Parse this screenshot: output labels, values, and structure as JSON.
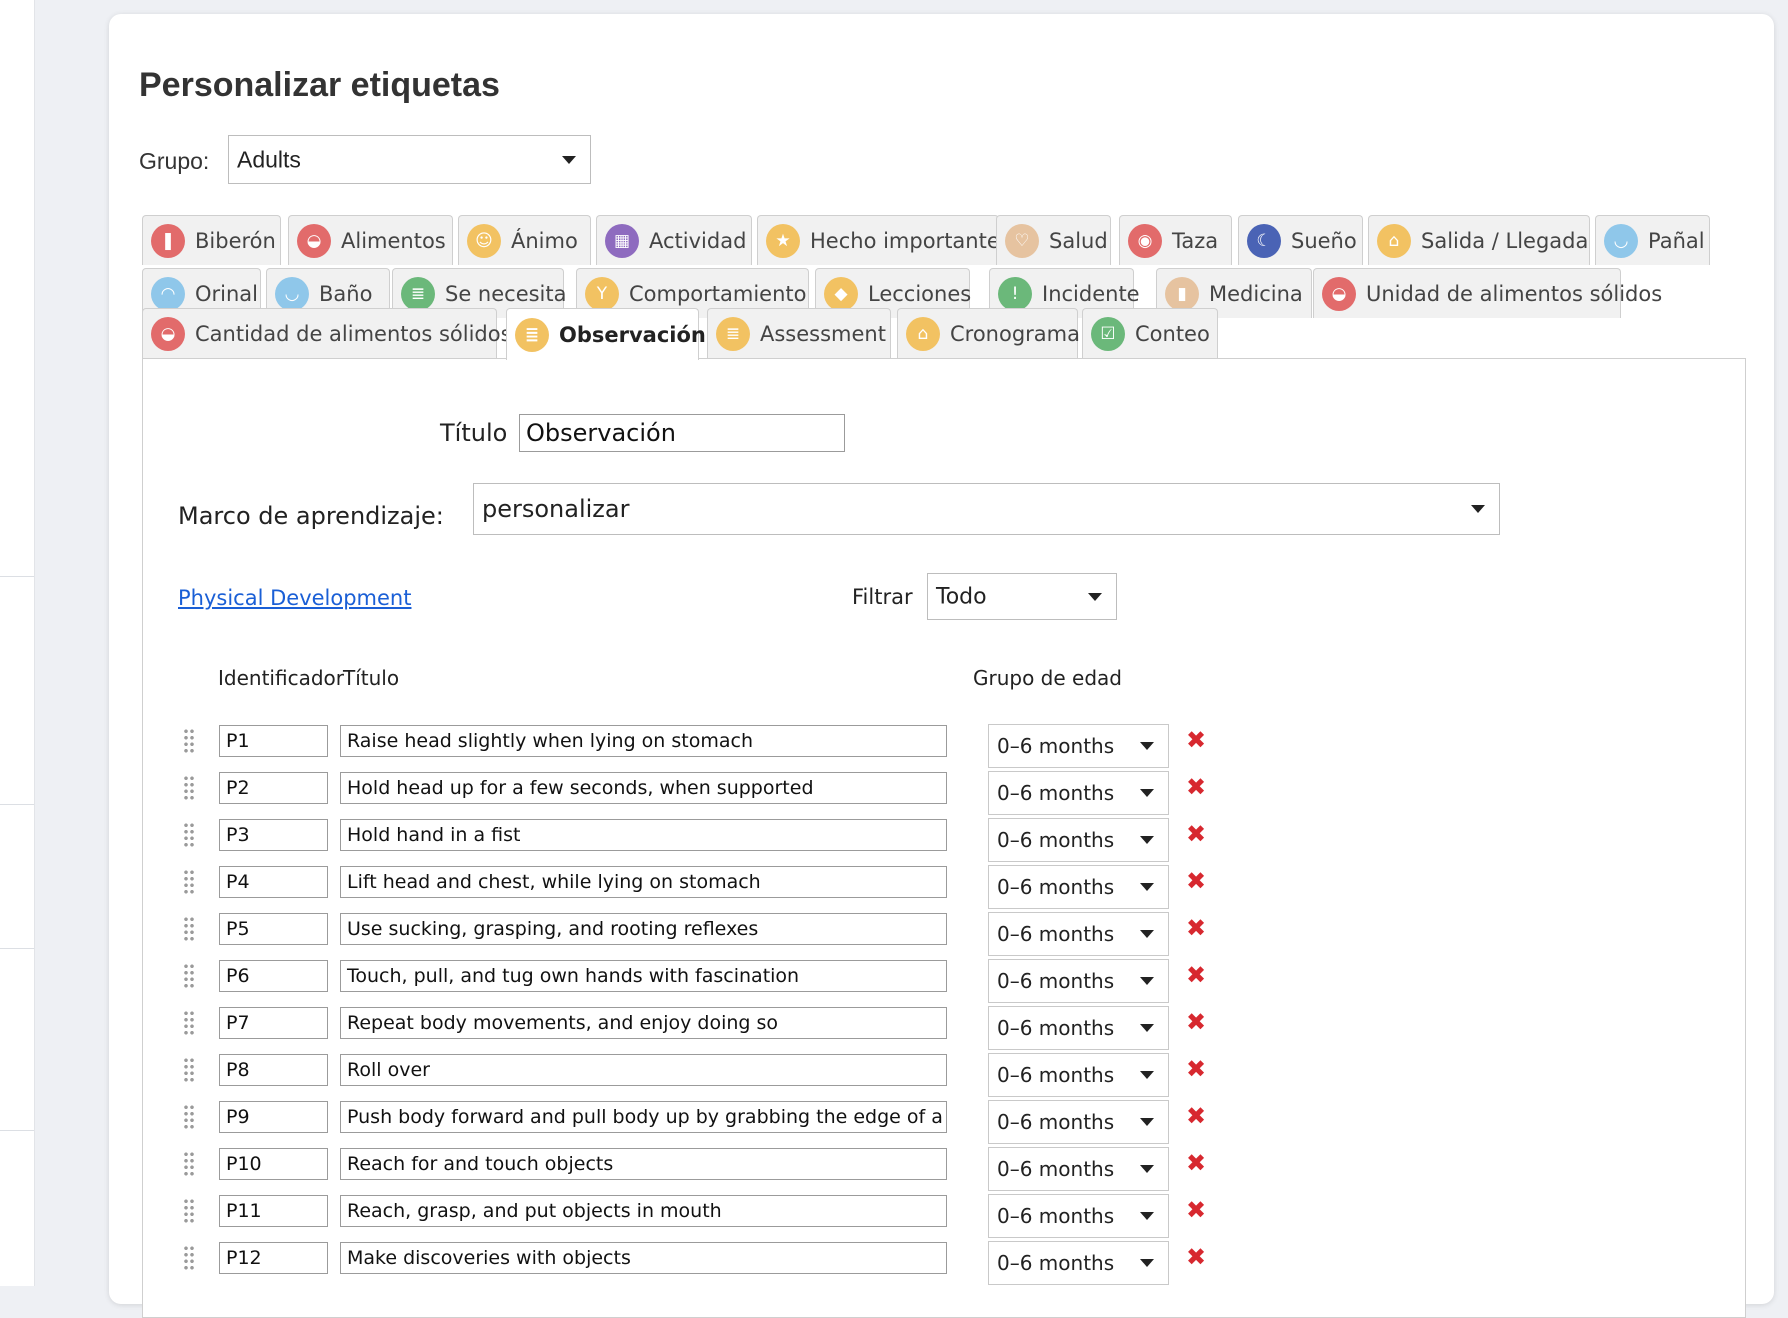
{
  "page": {
    "title": "Personalizar etiquetas",
    "group_label": "Grupo:",
    "group_value": "Adults"
  },
  "tabs_row1": [
    {
      "label": "Biberón",
      "icon": "bottle-icon",
      "color": "#e26b6b",
      "glyph": "❚"
    },
    {
      "label": "Alimentos",
      "icon": "bowl-icon",
      "color": "#e26b6b",
      "glyph": "◒"
    },
    {
      "label": "Ánimo",
      "icon": "mood-icon",
      "color": "#f2c262",
      "glyph": "☺"
    },
    {
      "label": "Actividad",
      "icon": "blocks-icon",
      "color": "#8e6bbf",
      "glyph": "▦"
    },
    {
      "label": "Hecho importante",
      "icon": "star-icon",
      "color": "#f2c262",
      "glyph": "★"
    },
    {
      "label": "Salud",
      "icon": "stethoscope-icon",
      "color": "#e6c3a0",
      "glyph": "♡"
    },
    {
      "label": "Taza",
      "icon": "cup-icon",
      "color": "#e26b6b",
      "glyph": "◉"
    },
    {
      "label": "Sueño",
      "icon": "moon-icon",
      "color": "#4a63b5",
      "glyph": "☾"
    },
    {
      "label": "Salida / Llegada",
      "icon": "house-icon",
      "color": "#f2c262",
      "glyph": "⌂"
    },
    {
      "label": "Pañal",
      "icon": "diaper-icon",
      "color": "#8fc7ea",
      "glyph": "◡"
    }
  ],
  "tabs_row2": [
    {
      "label": "Orinal",
      "icon": "potty-icon",
      "color": "#8fc7ea",
      "glyph": "◠"
    },
    {
      "label": "Baño",
      "icon": "bath-icon",
      "color": "#8fc7ea",
      "glyph": "◡"
    },
    {
      "label": "Se necesita",
      "icon": "clipboard-icon",
      "color": "#6bb87a",
      "glyph": "≣"
    },
    {
      "label": "Comportamiento",
      "icon": "scale-icon",
      "color": "#f2c262",
      "glyph": "Y"
    },
    {
      "label": "Lecciones",
      "icon": "graduation-cap-icon",
      "color": "#f2c262",
      "glyph": "◆"
    },
    {
      "label": "Incidente",
      "icon": "warning-icon",
      "color": "#6bb87a",
      "glyph": "!"
    },
    {
      "label": "Medicina",
      "icon": "medicine-icon",
      "color": "#e6c3a0",
      "glyph": "▮"
    },
    {
      "label": "Unidad de alimentos sólidos",
      "icon": "bowl-icon",
      "color": "#e26b6b",
      "glyph": "◒"
    }
  ],
  "tabs_row3": [
    {
      "label": "Cantidad de alimentos sólidos",
      "icon": "bowl-icon",
      "color": "#e26b6b",
      "glyph": "◒"
    },
    {
      "label": "Observación",
      "icon": "notepad-icon",
      "color": "#f2c262",
      "glyph": "≣",
      "active": true
    },
    {
      "label": "Assessment",
      "icon": "notepad-icon",
      "color": "#f2c262",
      "glyph": "≣"
    },
    {
      "label": "Cronograma",
      "icon": "house-icon",
      "color": "#f2c262",
      "glyph": "⌂"
    },
    {
      "label": "Conteo",
      "icon": "checklist-icon",
      "color": "#6bb87a",
      "glyph": "☑"
    }
  ],
  "form": {
    "title_label": "Título",
    "title_value": "Observación",
    "framework_label": "Marco de aprendizaje:",
    "framework_value": "personalizar",
    "section_link": "Physical Development",
    "filter_label": "Filtrar",
    "filter_value": "Todo",
    "col_identifier": "Identificador",
    "col_title": "Título",
    "col_age_group": "Grupo de edad"
  },
  "rows": [
    {
      "id": "P1",
      "title": "Raise head slightly when lying on stomach",
      "age": "0–6 months"
    },
    {
      "id": "P2",
      "title": "Hold head up for a few seconds, when supported",
      "age": "0–6 months"
    },
    {
      "id": "P3",
      "title": "Hold hand in a fist",
      "age": "0–6 months"
    },
    {
      "id": "P4",
      "title": "Lift head and chest, while lying on stomach",
      "age": "0–6 months"
    },
    {
      "id": "P5",
      "title": "Use sucking, grasping, and rooting reflexes",
      "age": "0–6 months"
    },
    {
      "id": "P6",
      "title": "Touch, pull, and tug own hands with fascination",
      "age": "0–6 months"
    },
    {
      "id": "P7",
      "title": "Repeat body movements, and enjoy doing so",
      "age": "0–6 months"
    },
    {
      "id": "P8",
      "title": "Roll over",
      "age": "0–6 months"
    },
    {
      "id": "P9",
      "title": "Push body forward and pull body up by grabbing the edge of a",
      "age": "0–6 months"
    },
    {
      "id": "P10",
      "title": "Reach for and touch objects",
      "age": "0–6 months"
    },
    {
      "id": "P11",
      "title": "Reach, grasp, and put objects in mouth",
      "age": "0–6 months"
    },
    {
      "id": "P12",
      "title": "Make discoveries with objects",
      "age": "0–6 months"
    }
  ]
}
